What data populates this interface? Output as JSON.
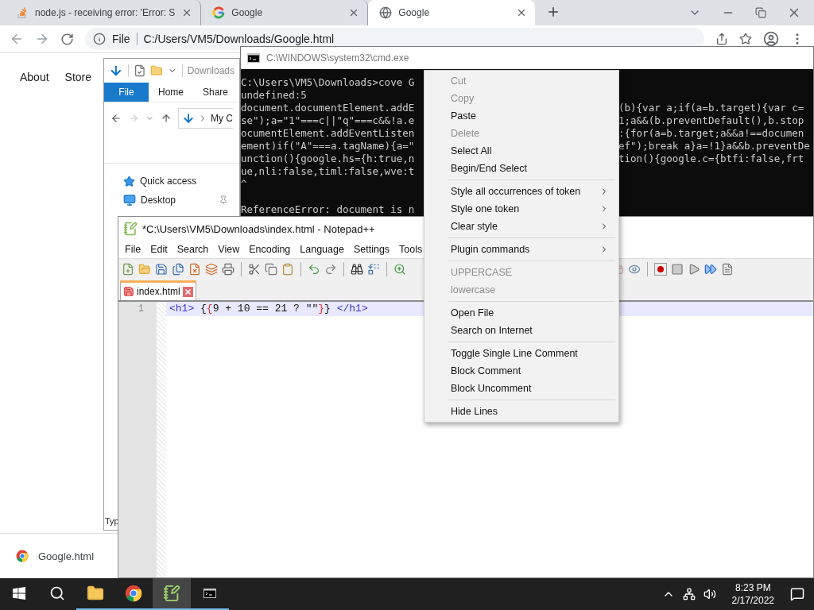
{
  "browser": {
    "tabs": [
      {
        "title": "node.js - receiving error: 'Error: S",
        "kind": "stack",
        "selected": false
      },
      {
        "title": "Google",
        "kind": "g",
        "selected": false
      },
      {
        "title": "Google",
        "kind": "globe",
        "selected": true
      }
    ],
    "address": {
      "scheme": "File",
      "url": "C:/Users/VM5/Downloads/Google.html"
    },
    "page_nav": [
      "About",
      "Store"
    ],
    "download": {
      "file": "Google.html"
    }
  },
  "explorer": {
    "quick_title": "Downloads",
    "ribbon_tabs": [
      {
        "label": "File",
        "selected": true
      },
      {
        "label": "Home",
        "selected": false
      },
      {
        "label": "Share",
        "selected": false
      }
    ],
    "path": "My C",
    "nav_items": [
      {
        "label": "Quick access",
        "kind": "quick"
      },
      {
        "label": "Desktop",
        "kind": "desktop"
      }
    ],
    "status": "Typ"
  },
  "console": {
    "title": "C:\\WINDOWS\\system32\\cmd.exe",
    "lines": [
      {
        "kind": "text",
        "left": "C:\\Users\\VM5\\Downloads>cove G"
      },
      {
        "kind": "text",
        "left": "undefined:5"
      },
      {
        "kind": "text",
        "left": "document.documentElement.addE",
        "right": "(b){var a;if(a=b.target){var c="
      },
      {
        "kind": "text",
        "left": "se\");a=\"1\"===c||\"q\"===c&&!a.e",
        "right": "1;a&&(b.preventDefault(),b.stop"
      },
      {
        "kind": "text",
        "left": "ocumentElement.addEventListen",
        "right": ":{for(a=b.target;a&&a!==documen"
      },
      {
        "kind": "text",
        "left": "ement)if(\"A\"===a.tagName){a=\"",
        "right": "ef\");break a}a=!1}a&&b.preventDe"
      },
      {
        "kind": "text",
        "left": "unction(){google.hs={h:true,n",
        "right": "tion(){google.c={btfi:false,frt"
      },
      {
        "kind": "text",
        "left": "ue,nli:false,timl:false,wve:t"
      },
      {
        "kind": "text",
        "left": "^"
      },
      {
        "kind": "blank"
      },
      {
        "kind": "text",
        "left": "ReferenceError: document is n"
      }
    ]
  },
  "notepad": {
    "title": "*C:\\Users\\VM5\\Downloads\\index.html - Notepad++",
    "menu": [
      "File",
      "Edit",
      "Search",
      "View",
      "Encoding",
      "Language",
      "Settings",
      "Tools"
    ],
    "tabs": [
      {
        "label": "index.html",
        "selected": true
      }
    ],
    "lines": [
      {
        "number": "1",
        "tokens": [
          {
            "text": "<h1>",
            "kind": "tag"
          },
          {
            "text": " {",
            "kind": "plain"
          },
          {
            "text": "{",
            "kind": "brace"
          },
          {
            "text": "9 + 10 == 21 ? \"\"",
            "kind": "plain"
          },
          {
            "text": "}",
            "kind": "brace"
          },
          {
            "text": "} ",
            "kind": "plain"
          },
          {
            "text": "</h1>",
            "kind": "tag"
          }
        ]
      }
    ]
  },
  "context_menu": {
    "items": [
      {
        "kind": "item",
        "label": "Cut",
        "disabled": true,
        "submenu": false
      },
      {
        "kind": "item",
        "label": "Copy",
        "disabled": true,
        "submenu": false
      },
      {
        "kind": "item",
        "label": "Paste",
        "disabled": false,
        "submenu": false
      },
      {
        "kind": "item",
        "label": "Delete",
        "disabled": true,
        "submenu": false
      },
      {
        "kind": "item",
        "label": "Select All",
        "disabled": false,
        "submenu": false
      },
      {
        "kind": "item",
        "label": "Begin/End Select",
        "disabled": false,
        "submenu": false
      },
      {
        "kind": "separator"
      },
      {
        "kind": "item",
        "label": "Style all occurrences of token",
        "disabled": false,
        "submenu": true
      },
      {
        "kind": "item",
        "label": "Style one token",
        "disabled": false,
        "submenu": true
      },
      {
        "kind": "item",
        "label": "Clear style",
        "disabled": false,
        "submenu": true
      },
      {
        "kind": "separator"
      },
      {
        "kind": "item",
        "label": "Plugin commands",
        "disabled": false,
        "submenu": true
      },
      {
        "kind": "separator"
      },
      {
        "kind": "item",
        "label": "UPPERCASE",
        "disabled": true,
        "submenu": false
      },
      {
        "kind": "item",
        "label": "lowercase",
        "disabled": true,
        "submenu": false
      },
      {
        "kind": "separator"
      },
      {
        "kind": "item",
        "label": "Open File",
        "disabled": false,
        "submenu": false
      },
      {
        "kind": "item",
        "label": "Search on Internet",
        "disabled": false,
        "submenu": false
      },
      {
        "kind": "separator"
      },
      {
        "kind": "item",
        "label": "Toggle Single Line Comment",
        "disabled": false,
        "submenu": false
      },
      {
        "kind": "item",
        "label": "Block Comment",
        "disabled": false,
        "submenu": false
      },
      {
        "kind": "item",
        "label": "Block Uncomment",
        "disabled": false,
        "submenu": false
      },
      {
        "kind": "separator"
      },
      {
        "kind": "item",
        "label": "Hide Lines",
        "disabled": false,
        "submenu": false
      }
    ]
  },
  "taskbar": {
    "apps": [
      {
        "kind": "explorer",
        "active": false
      },
      {
        "kind": "browser",
        "active": false
      },
      {
        "kind": "notepad",
        "active": true
      },
      {
        "kind": "console",
        "active": false
      }
    ],
    "time": "8:23 PM",
    "date": "2/17/2022"
  }
}
